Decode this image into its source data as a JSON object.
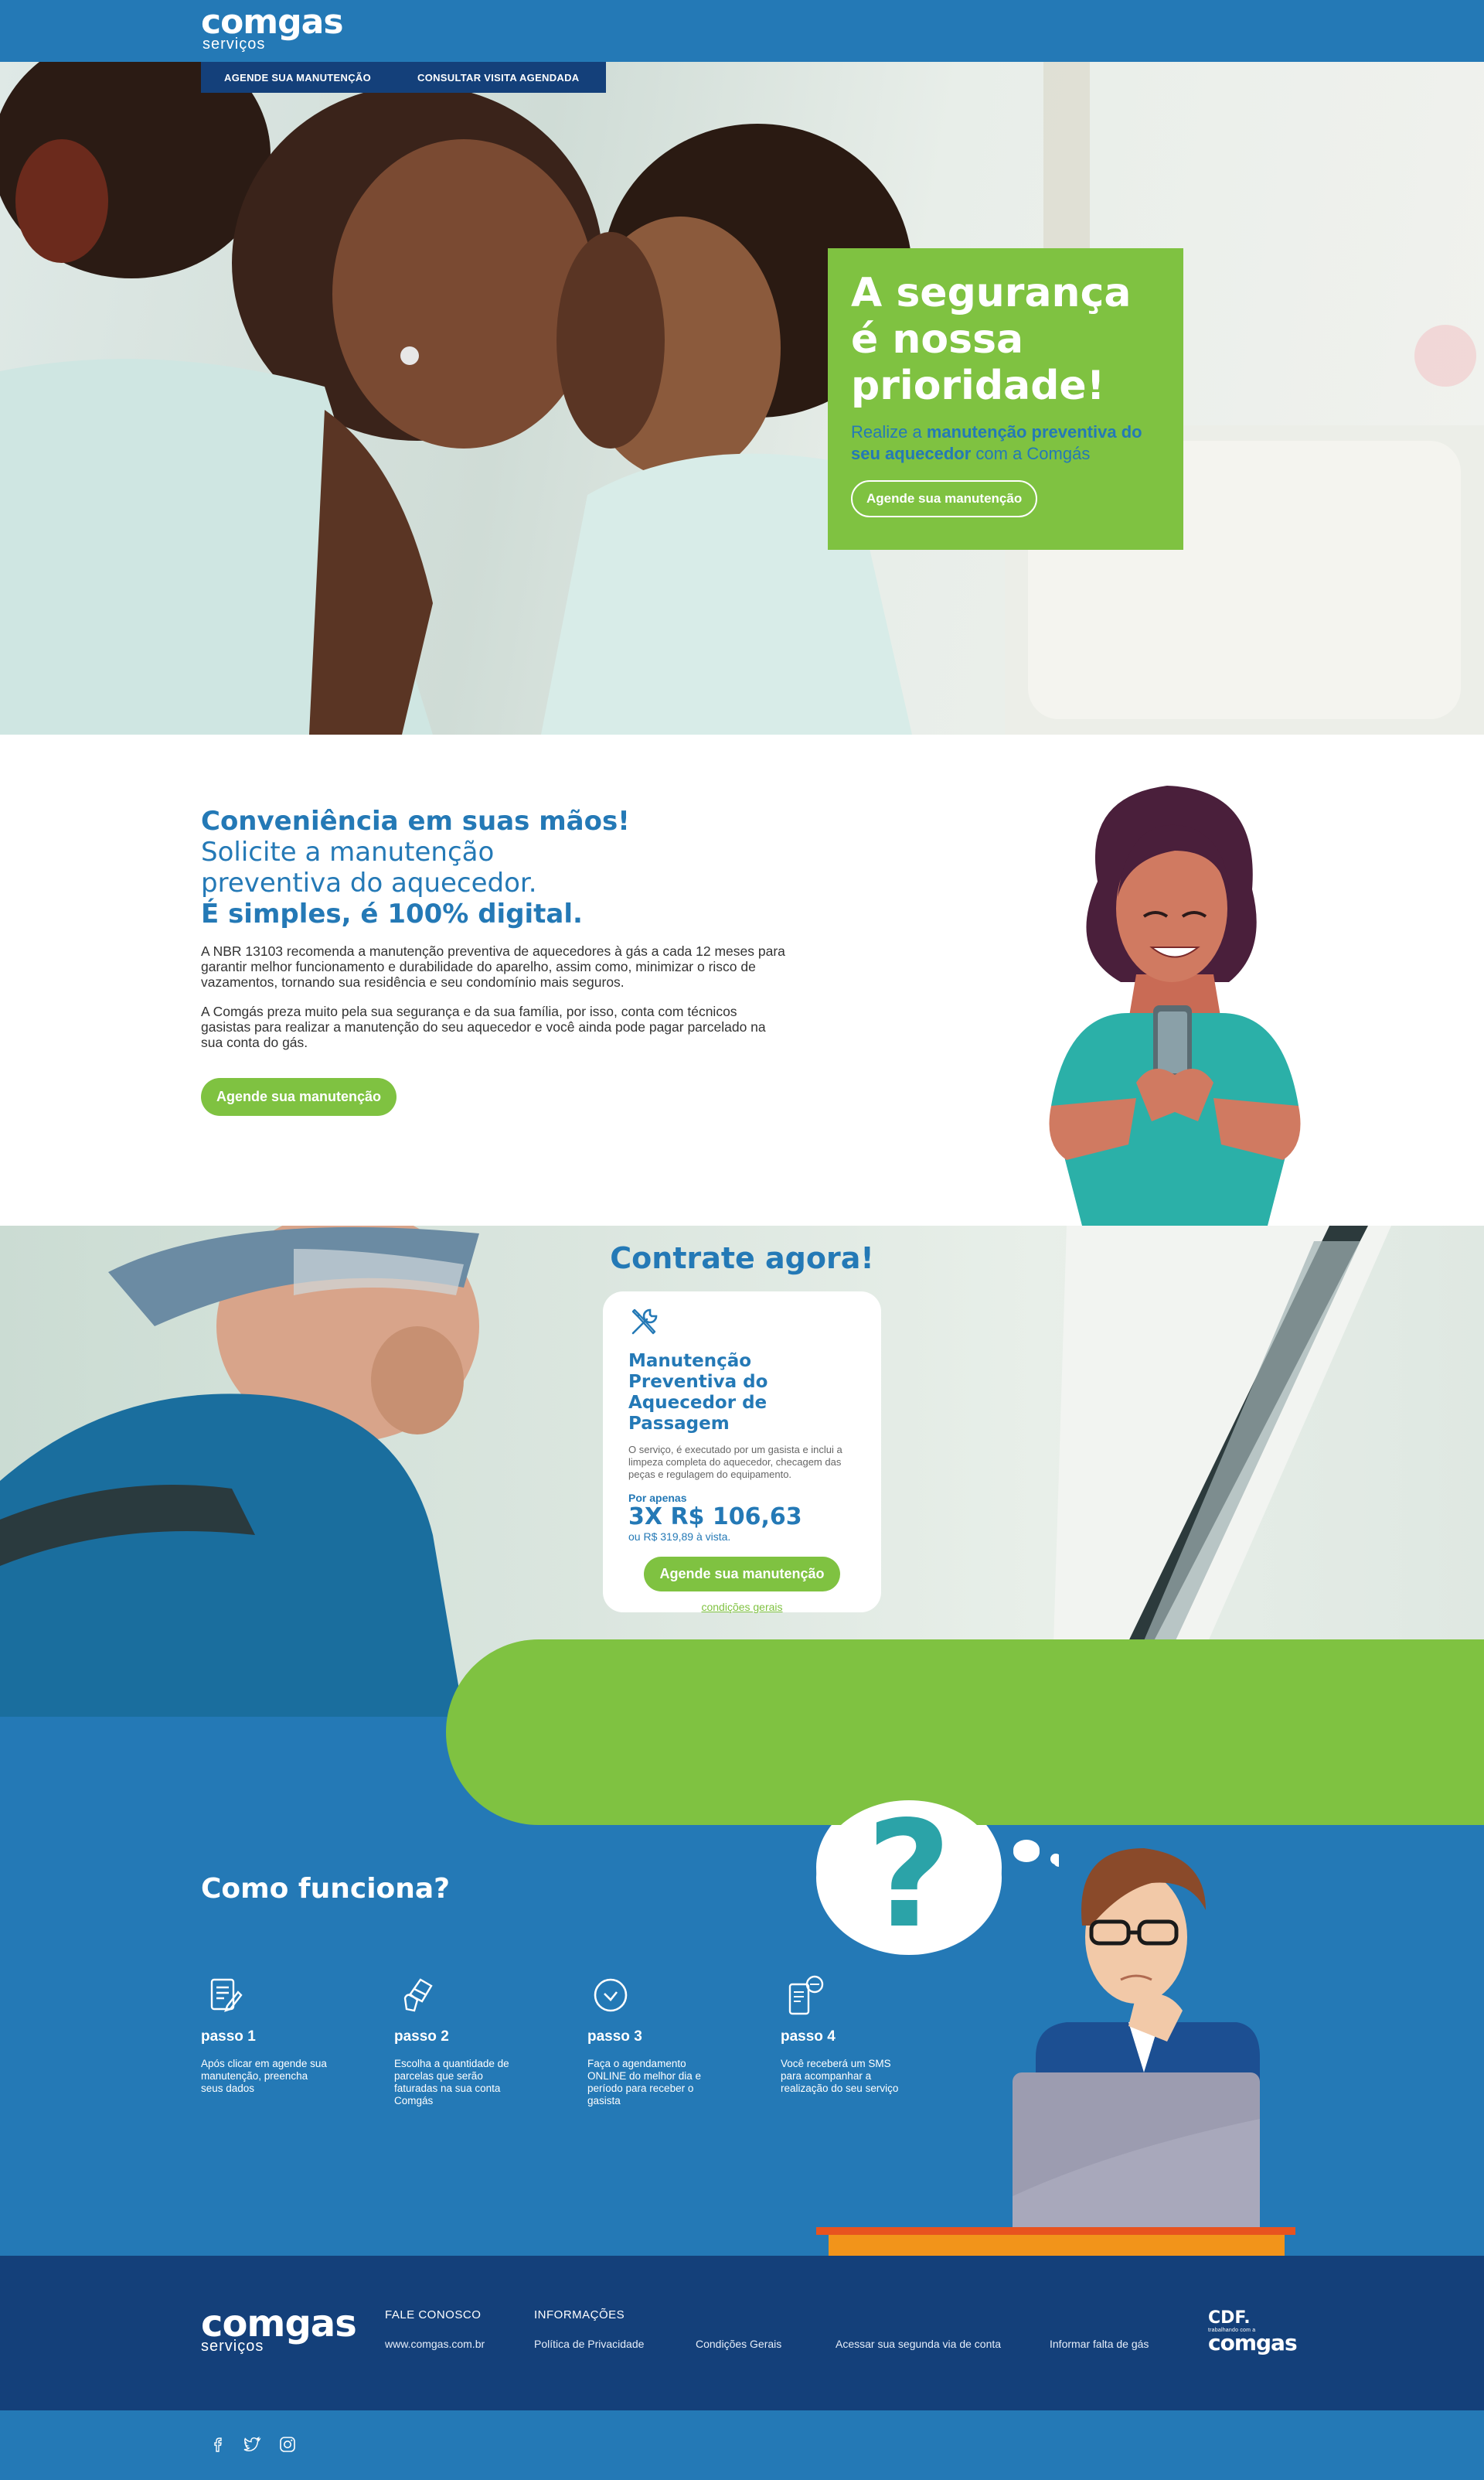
{
  "header": {
    "brand": "comgas",
    "brand_sub": "serviços",
    "nav": [
      "AGENDE SUA MANUTENÇÃO",
      "CONSULTAR VISITA AGENDADA"
    ]
  },
  "hero": {
    "title_lines": [
      "A segurança",
      "é nossa",
      "prioridade!"
    ],
    "subtitle_prefix": "Realize a ",
    "subtitle_bold": "manutenção preventiva do seu aquecedor",
    "subtitle_suffix": " com a Comgás",
    "button": "Agende sua manutenção"
  },
  "convenience": {
    "title_1": "Conveniência em suas mãos!",
    "title_2a": "Solicite a manutenção",
    "title_2b": "preventiva do aquecedor.",
    "title_3": "É simples, é 100% digital.",
    "paragraph_1": "A NBR 13103 recomenda a manutenção preventiva de aquecedores à gás a cada 12 meses para garantir melhor funcionamento e durabilidade do aparelho, assim como, minimizar o risco de vazamentos, tornando sua residência e seu condomínio mais seguros.",
    "paragraph_2": "A Comgás preza muito pela sua segurança e da sua família, por isso, conta com técnicos gasistas para realizar a manutenção do seu aquecedor e você ainda pode pagar parcelado na sua conta do gás.",
    "button": "Agende sua manutenção"
  },
  "contrate": {
    "title": "Contrate agora!",
    "card": {
      "icon": "tools-icon",
      "title": "Manutenção Preventiva do Aquecedor de Passagem",
      "description": "O serviço, é executado por um gasista e inclui a limpeza completa do aquecedor, checagem das peças e regulagem do equipamento.",
      "por_apenas": "Por apenas",
      "price": "3X R$ 106,63",
      "price_vista": "ou R$ 319,89 à vista.",
      "button": "Agende sua manutenção",
      "conditions": "condições gerais"
    }
  },
  "como_funciona": {
    "title": "Como funciona?",
    "bubble": "?",
    "steps": [
      {
        "icon": "form-icon",
        "title": "passo 1",
        "text": "Após clicar em agende sua manutenção, preencha seus dados"
      },
      {
        "icon": "card-icon",
        "title": "passo 2",
        "text": "Escolha a quantidade de parcelas que serão faturadas na sua conta Comgás"
      },
      {
        "icon": "clock-icon",
        "title": "passo 3",
        "text": "Faça o agendamento ONLINE do melhor dia e período para receber o gasista"
      },
      {
        "icon": "sms-icon",
        "title": "passo 4",
        "text": "Você receberá um SMS para acompanhar a realização do seu serviço"
      }
    ]
  },
  "footer": {
    "brand": "comgas",
    "brand_sub": "serviços",
    "fale_conosco": "FALE CONOSCO",
    "site": "www.comgas.com.br",
    "informacoes": "INFORMAÇÕES",
    "links": [
      "Política de Privacidade",
      "Condições Gerais",
      "Acessar sua segunda via de conta",
      "Informar falta de gás"
    ],
    "cdf_title": "CDF.",
    "cdf_sub": "trabalhando com a",
    "cdf_brand": "comgas"
  },
  "colors": {
    "blue": "#2479b6",
    "dark_blue": "#14407a",
    "green": "#7fc241"
  }
}
